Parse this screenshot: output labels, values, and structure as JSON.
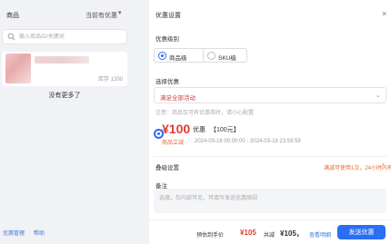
{
  "left": {
    "header": {
      "product_label": "商品",
      "promo_label": "当前有优惠"
    },
    "search": {
      "placeholder": "输入商品ID/关键词"
    },
    "product": {
      "stock": "库存 1200"
    },
    "no_more": "没有更多了",
    "footer": {
      "manage": "优惠管理",
      "help": "帮助"
    }
  },
  "right": {
    "title": "优惠设置",
    "level": {
      "label": "优惠级别",
      "options": [
        "商品级",
        "SKU级"
      ],
      "selected": "商品级"
    },
    "choose": {
      "label": "选择优惠",
      "selected_value": "满足全部活动",
      "note": "注意：商品仅可有优惠券时，请小心配置"
    },
    "coupon": {
      "amount": "¥100",
      "type": "优惠",
      "threshold": "【100元】",
      "tag": "商品立减",
      "time": "2024-03-16 00:00:00 - 2024-03-18 23:59:59"
    },
    "stack": {
      "label": "叠级设置",
      "rule": "满减可使用1次，24小时内有效"
    },
    "remark": {
      "label": "备注",
      "placeholder": "选填，仅内部可见，可填写发送优惠原因"
    }
  },
  "footer": {
    "est_label": "预估到手价",
    "est_price": "¥105",
    "total_label": "共减",
    "total_value": "¥105，",
    "details": "查看明细",
    "send": "发送优惠"
  },
  "colors": {
    "primary": "#2a6ef3",
    "price": "#e63b2e",
    "accent": "#e46b2e"
  }
}
